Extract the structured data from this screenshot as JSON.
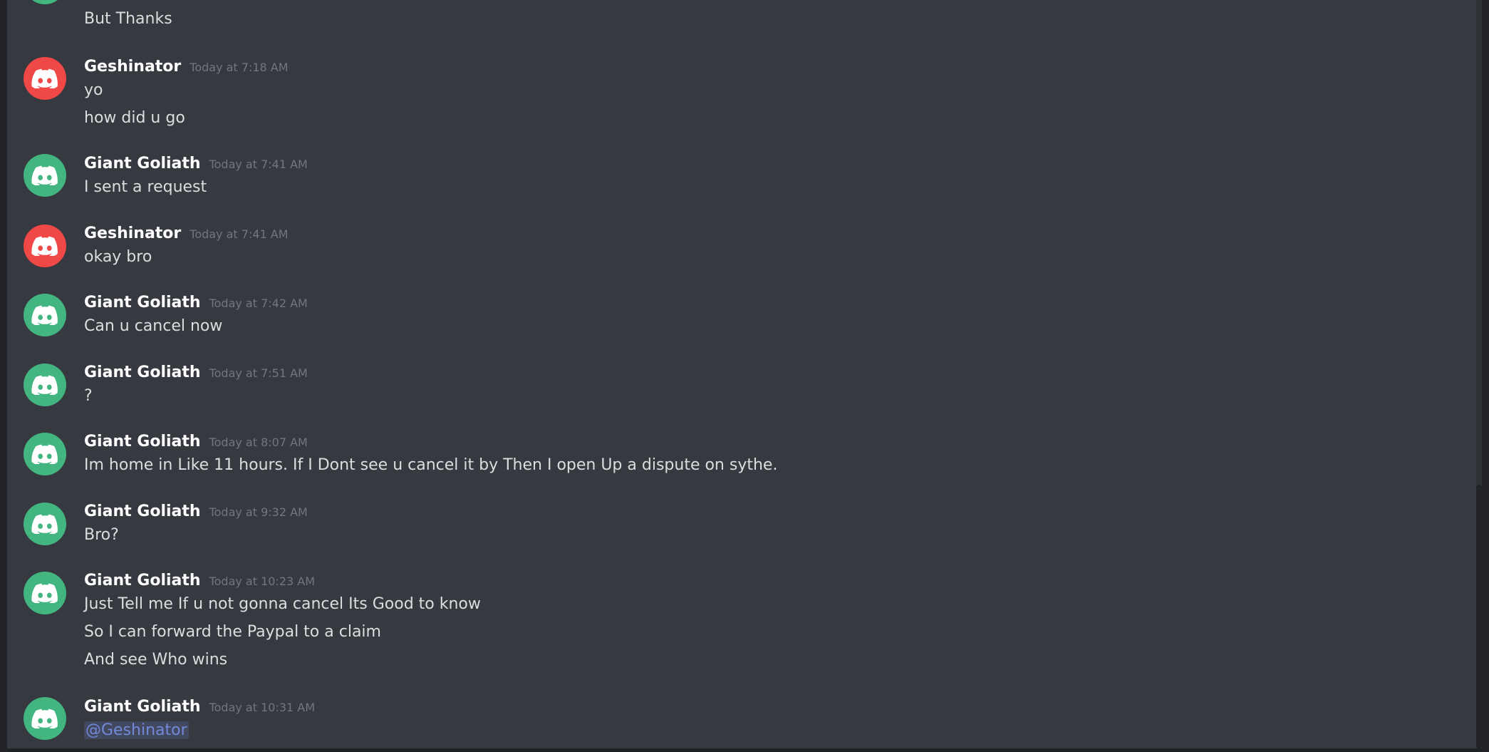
{
  "colors": {
    "background": "#36393f",
    "avatar_red": "#f04747",
    "avatar_green": "#43b581",
    "mention": "#7289da"
  },
  "messages": [
    {
      "partial_first": true,
      "avatar_color": "green",
      "lines": [
        "But Thanks"
      ]
    },
    {
      "author": "Geshinator",
      "timestamp": "Today at 7:18 AM",
      "avatar_color": "red",
      "lines": [
        "yo",
        "how did u go"
      ]
    },
    {
      "author": "Giant Goliath",
      "timestamp": "Today at 7:41 AM",
      "avatar_color": "green",
      "lines": [
        "I sent a request"
      ]
    },
    {
      "author": "Geshinator",
      "timestamp": "Today at 7:41 AM",
      "avatar_color": "red",
      "lines": [
        "okay bro"
      ]
    },
    {
      "author": "Giant Goliath",
      "timestamp": "Today at 7:42 AM",
      "avatar_color": "green",
      "lines": [
        "Can u cancel now"
      ]
    },
    {
      "author": "Giant Goliath",
      "timestamp": "Today at 7:51 AM",
      "avatar_color": "green",
      "lines": [
        "?"
      ]
    },
    {
      "author": "Giant Goliath",
      "timestamp": "Today at 8:07 AM",
      "avatar_color": "green",
      "lines": [
        "Im home in Like 11 hours. If I Dont see u cancel it by Then I open Up a dispute on sythe."
      ]
    },
    {
      "author": "Giant Goliath",
      "timestamp": "Today at 9:32 AM",
      "avatar_color": "green",
      "lines": [
        "Bro?"
      ]
    },
    {
      "author": "Giant Goliath",
      "timestamp": "Today at 10:23 AM",
      "avatar_color": "green",
      "lines": [
        "Just Tell me If u not gonna cancel Its Good to know",
        "So I can forward the Paypal to a claim",
        "And see Who wins"
      ]
    },
    {
      "author": "Giant Goliath",
      "timestamp": "Today at 10:31 AM",
      "avatar_color": "green",
      "lines": [
        "@Geshinator"
      ],
      "mention": true
    }
  ]
}
